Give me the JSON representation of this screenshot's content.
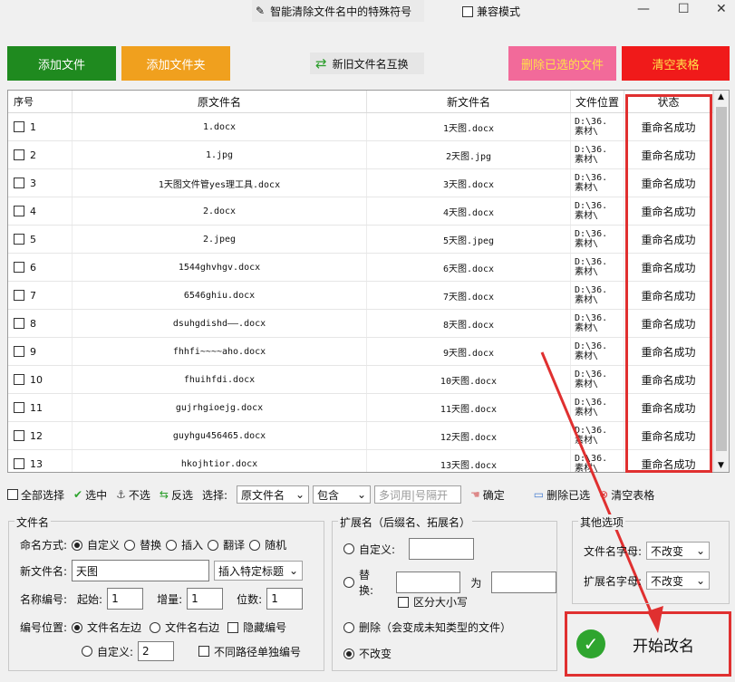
{
  "window": {
    "title": "智能清除文件名中的特殊符号",
    "compat_label": "兼容模式",
    "min_glyph": "—",
    "max_glyph": "☐",
    "close_glyph": "✕"
  },
  "buttons": {
    "add_file": "添加文件",
    "add_folder": "添加文件夹",
    "swap": "新旧文件名互换",
    "delete_selected": "删除已选的文件",
    "clear_table": "清空表格"
  },
  "colors": {
    "green": "#1f8a1f",
    "orange": "#f0a01e",
    "pink": "#f26a9a",
    "red": "#f01a1a",
    "highlight": "#e03030"
  },
  "table": {
    "headers": [
      "序号",
      "原文件名",
      "新文件名",
      "文件位置",
      "状态"
    ],
    "rows": [
      {
        "n": "1",
        "orig": "1.docx",
        "new": "1天图.docx",
        "loc1": "D:\\36.",
        "loc2": "素材\\",
        "status": "重命名成功"
      },
      {
        "n": "2",
        "orig": "1.jpg",
        "new": "2天图.jpg",
        "loc1": "D:\\36.",
        "loc2": "素材\\",
        "status": "重命名成功"
      },
      {
        "n": "3",
        "orig": "1天图文件管yes理工具.docx",
        "new": "3天图.docx",
        "loc1": "D:\\36.",
        "loc2": "素材\\",
        "status": "重命名成功"
      },
      {
        "n": "4",
        "orig": "2.docx",
        "new": "4天图.docx",
        "loc1": "D:\\36.",
        "loc2": "素材\\",
        "status": "重命名成功"
      },
      {
        "n": "5",
        "orig": "2.jpeg",
        "new": "5天图.jpeg",
        "loc1": "D:\\36.",
        "loc2": "素材\\",
        "status": "重命名成功"
      },
      {
        "n": "6",
        "orig": "1544ghvhgv.docx",
        "new": "6天图.docx",
        "loc1": "D:\\36.",
        "loc2": "素材\\",
        "status": "重命名成功"
      },
      {
        "n": "7",
        "orig": "6546ghiu.docx",
        "new": "7天图.docx",
        "loc1": "D:\\36.",
        "loc2": "素材\\",
        "status": "重命名成功"
      },
      {
        "n": "8",
        "orig": "dsuhgdishd——.docx",
        "new": "8天图.docx",
        "loc1": "D:\\36.",
        "loc2": "素材\\",
        "status": "重命名成功"
      },
      {
        "n": "9",
        "orig": "fhhfi~~~~aho.docx",
        "new": "9天图.docx",
        "loc1": "D:\\36.",
        "loc2": "素材\\",
        "status": "重命名成功"
      },
      {
        "n": "10",
        "orig": "fhuihfdi.docx",
        "new": "10天图.docx",
        "loc1": "D:\\36.",
        "loc2": "素材\\",
        "status": "重命名成功"
      },
      {
        "n": "11",
        "orig": "gujrhgioejg.docx",
        "new": "11天图.docx",
        "loc1": "D:\\36.",
        "loc2": "素材\\",
        "status": "重命名成功"
      },
      {
        "n": "12",
        "orig": "guyhgu456465.docx",
        "new": "12天图.docx",
        "loc1": "D:\\36.",
        "loc2": "素材\\",
        "status": "重命名成功"
      },
      {
        "n": "13",
        "orig": "hkojhtior.docx",
        "new": "13天图.docx",
        "loc1": "D:\\36.",
        "loc2": "素材\\",
        "status": "重命名成功"
      }
    ]
  },
  "toolbar": {
    "select_all": "全部选择",
    "select": "选中",
    "deselect": "不选",
    "invert": "反选",
    "choose_label": "选择:",
    "field_value": "原文件名",
    "mode_value": "包含",
    "keyword_placeholder": "多词用|号隔开",
    "confirm": "确定",
    "delete_selected": "删除已选",
    "clear_table": "清空表格"
  },
  "filename": {
    "group": "文件名",
    "method_label": "命名方式:",
    "methods": [
      "自定义",
      "替换",
      "插入",
      "翻译",
      "随机"
    ],
    "new_name_label": "新文件名:",
    "new_name_value": "天图",
    "insert_title": "插入特定标题",
    "number_label": "名称编号:",
    "start_label": "起始:",
    "start_value": "1",
    "inc_label": "增量:",
    "inc_value": "1",
    "digits_label": "位数:",
    "digits_value": "1",
    "pos_label": "编号位置:",
    "pos_left": "文件名左边",
    "pos_right": "文件名右边",
    "hide_number": "隐藏编号",
    "custom": "自定义:",
    "custom_value": "2",
    "separate": "不同路径单独编号"
  },
  "extension": {
    "group": "扩展名（后缀名、拓展名）",
    "custom": "自定义:",
    "replace": "替换:",
    "to": "为",
    "case": "区分大小写",
    "delete": "删除（会变成未知类型的文件）",
    "keep": "不改变"
  },
  "other": {
    "group": "其他选项",
    "name_case_label": "文件名字母:",
    "name_case_value": "不改变",
    "ext_case_label": "扩展名字母:",
    "ext_case_value": "不改变"
  },
  "start_button": "开始改名"
}
